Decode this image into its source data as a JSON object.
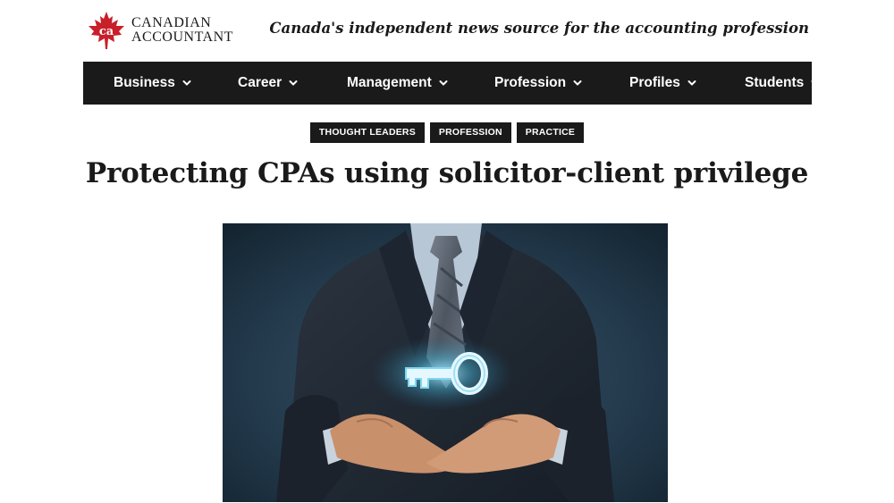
{
  "header": {
    "logo_abbr": "ca",
    "logo_line1": "CANADIAN",
    "logo_line2": "ACCOUNTANT",
    "tagline": "Canada's independent news source for the accounting profession"
  },
  "nav": {
    "items": [
      {
        "label": "Business"
      },
      {
        "label": "Career"
      },
      {
        "label": "Management"
      },
      {
        "label": "Profession"
      },
      {
        "label": "Profiles"
      },
      {
        "label": "Students"
      }
    ]
  },
  "article": {
    "tags": [
      "THOUGHT LEADERS",
      "PROFESSION",
      "PRACTICE"
    ],
    "title": "Protecting CPAs using solicitor-client privilege"
  },
  "colors": {
    "nav_bg": "#1a1a1a",
    "maple_red": "#c8202a",
    "key_glow": "#7fd8f2"
  },
  "icons": {
    "logo": "maple-leaf-icon",
    "nav_dropdown": "chevron-down-icon"
  }
}
